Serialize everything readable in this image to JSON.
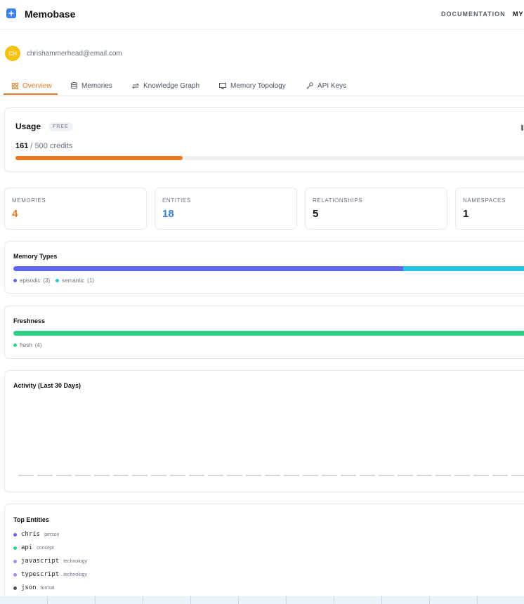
{
  "header": {
    "brand": "Memobase",
    "nav_documentation": "DOCUMENTATION",
    "nav_my": "MY"
  },
  "user": {
    "initials": "CH",
    "email": "chrishammerhead@email.com"
  },
  "tabs": [
    {
      "label": "Overview",
      "icon": "grid-icon",
      "active": true
    },
    {
      "label": "Memories",
      "icon": "database-icon",
      "active": false
    },
    {
      "label": "Knowledge Graph",
      "icon": "arrows-icon",
      "active": false
    },
    {
      "label": "Memory Topology",
      "icon": "monitor-icon",
      "active": false
    },
    {
      "label": "API Keys",
      "icon": "key-icon",
      "active": false
    }
  ],
  "usage": {
    "title": "Usage",
    "plan_badge": "FREE",
    "used": "161",
    "rest": "/ 500 credits",
    "used_fraction": 0.322,
    "fill_color": "#ea7a22"
  },
  "stats": [
    {
      "label": "MEMORIES",
      "value": "4",
      "color": "#ea7a22"
    },
    {
      "label": "ENTITIES",
      "value": "18",
      "color": "#3b7fd4"
    },
    {
      "label": "RELATIONSHIPS",
      "value": "5",
      "color": "#111111"
    },
    {
      "label": "NAMESPACES",
      "value": "1",
      "color": "#111111"
    }
  ],
  "memory_types": {
    "title": "Memory Types",
    "segments": [
      {
        "name": "episodic",
        "count": "(3)",
        "value": 3,
        "color": "#6366f1"
      },
      {
        "name": "semantic",
        "count": "(1)",
        "value": 1,
        "color": "#22c6e0"
      }
    ]
  },
  "freshness": {
    "title": "Freshness",
    "segments": [
      {
        "name": "fresh",
        "count": "(4)",
        "value": 4,
        "color": "#34d08a"
      }
    ]
  },
  "activity": {
    "title": "Activity (Last 30 Days)",
    "days": 27
  },
  "top_entities": {
    "title": "Top Entities",
    "items": [
      {
        "name": "chris",
        "type": "person",
        "color": "#6366f1"
      },
      {
        "name": "api",
        "type": "concept",
        "color": "#34d08a"
      },
      {
        "name": "javascript",
        "type": "technology",
        "color": "#a78bfa"
      },
      {
        "name": "typescript",
        "type": "technology",
        "color": "#a78bfa"
      },
      {
        "name": "json",
        "type": "format",
        "color": "#4b5563"
      }
    ]
  }
}
